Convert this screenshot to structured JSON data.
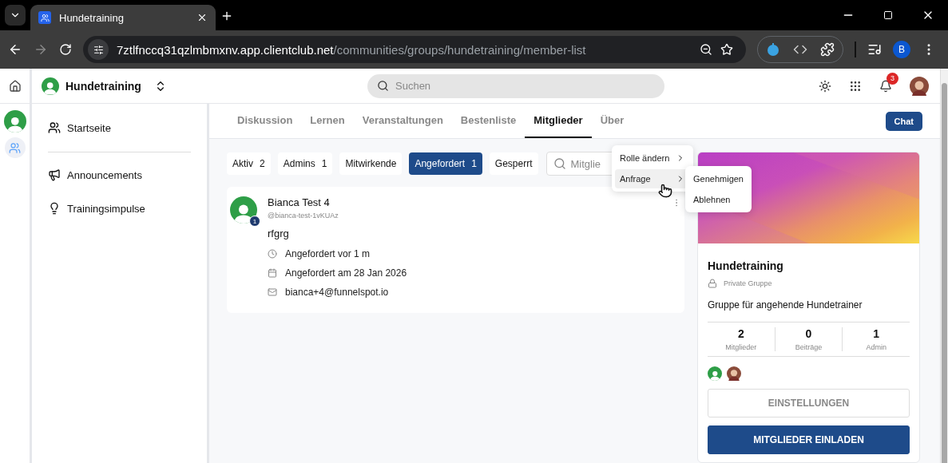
{
  "browser": {
    "tab_title": "Hundetraining",
    "url_host": "7ztlfnccq31qzlmbmxnv.app.clientclub.net",
    "url_path": "/communities/groups/hundetraining/member-list",
    "profile": "B"
  },
  "header": {
    "group_name": "Hundetraining",
    "search_placeholder": "Suchen",
    "notification_count": "3"
  },
  "sidebar": {
    "items": [
      {
        "label": "Startseite",
        "kind": "people"
      },
      {
        "label": "Announcements",
        "kind": "megaphone"
      },
      {
        "label": "Trainingsimpulse",
        "kind": "bulb"
      }
    ]
  },
  "tabs": [
    {
      "label": "Diskussion",
      "selected": false
    },
    {
      "label": "Lernen",
      "selected": false
    },
    {
      "label": "Veranstaltungen",
      "selected": false
    },
    {
      "label": "Bestenliste",
      "selected": false
    },
    {
      "label": "Mitglieder",
      "selected": true
    },
    {
      "label": "Über",
      "selected": false
    }
  ],
  "chat_button": "Chat",
  "filters": [
    {
      "label": "Aktiv",
      "count": "2",
      "selected": false
    },
    {
      "label": "Admins",
      "count": "1",
      "selected": false
    },
    {
      "label": "Mitwirkende",
      "selected": false
    },
    {
      "label": "Angefordert",
      "count": "1",
      "selected": true
    },
    {
      "label": "Gesperrt",
      "selected": false
    }
  ],
  "member_search": {
    "placeholder": "Mitglie"
  },
  "member": {
    "name": "Bianca Test 4",
    "handle": "@bianca-test-1vKUAz",
    "badge": "1",
    "bio": "rfgrg",
    "details": [
      {
        "kind": "clock",
        "text": "Angefordert vor 1 m"
      },
      {
        "kind": "calendar",
        "text": "Angefordert am 28 Jan 2026"
      },
      {
        "kind": "mail",
        "text": "bianca+4@funnelspot.io"
      }
    ]
  },
  "context_menu": {
    "items": [
      {
        "label": "Rolle ändern",
        "selected": false
      },
      {
        "label": "Anfrage",
        "selected": true
      }
    ],
    "submenu": [
      "Genehmigen",
      "Ablehnen"
    ]
  },
  "group_card": {
    "name": "Hundetraining",
    "privacy": "Private Gruppe",
    "description": "Gruppe für angehende Hundetrainer",
    "stats": [
      {
        "value": "2",
        "label": "Mitglieder"
      },
      {
        "value": "0",
        "label": "Beiträge"
      },
      {
        "value": "1",
        "label": "Admin"
      }
    ],
    "buttons": [
      {
        "label": "EINSTELLUNGEN",
        "kind": "outline"
      },
      {
        "label": "MITGLIEDER EINLADEN",
        "kind": "primary"
      }
    ]
  }
}
